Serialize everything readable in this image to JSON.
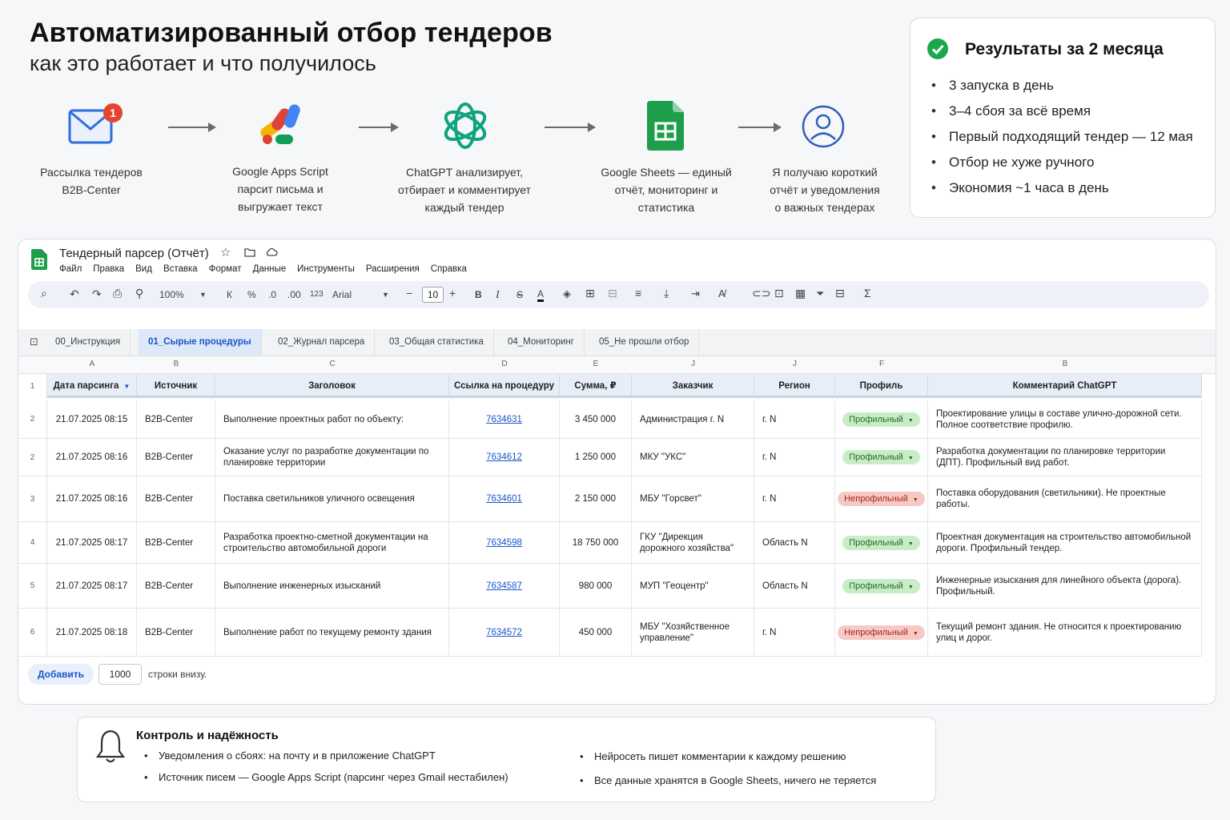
{
  "header": {
    "title": "Автоматизированный отбор тендеров",
    "subtitle": "как это работает и что получилось"
  },
  "flow": [
    {
      "icon": "envelope-icon",
      "badge": "1",
      "lines": [
        "Рассылка тендеров",
        "B2B-Center"
      ]
    },
    {
      "icon": "apps-script-icon",
      "lines": [
        "Google Apps Script",
        "парсит письма и",
        "выгружает текст"
      ]
    },
    {
      "icon": "chatgpt-icon",
      "lines": [
        "ChatGPT анализирует,",
        "отбирает и комментирует",
        "каждый тендер"
      ]
    },
    {
      "icon": "google-sheets-icon",
      "lines": [
        "Google Sheets — единый",
        "отчёт, мониторинг и",
        "статистика"
      ]
    },
    {
      "icon": "user-icon",
      "lines": [
        "Я получаю короткий",
        "отчёт и уведомления",
        "о важных тендерах"
      ]
    }
  ],
  "results": {
    "title": "Результаты за 2 месяца",
    "items": [
      "3 запуска в день",
      "3–4 сбоя за всё время",
      "Первый подходящий тендер — 12 мая",
      "Отбор не хуже ручного",
      "Экономия ~1 часа в день"
    ]
  },
  "sheet": {
    "doc_title": "Тендерный парсер (Отчёт)",
    "menu": [
      "Файл",
      "Правка",
      "Вид",
      "Вставка",
      "Формат",
      "Данные",
      "Инструменты",
      "Расширения",
      "Справка"
    ],
    "toolbar": {
      "zoom": "100%",
      "currency": "К",
      "percent": "%",
      "dec_less": ".0",
      "dec_more": ".00",
      "format_123": "123",
      "font": "Arial",
      "font_size": "10"
    },
    "tabs": [
      "00_Инструкция",
      "01_Сырые процедуры",
      "02_Журнал парсера",
      "03_Общая статистика",
      "04_Мониторинг",
      "05_Не прошли отбор"
    ],
    "active_tab": 1,
    "column_letters": [
      "A",
      "B",
      "C",
      "D",
      "E",
      "J",
      "J",
      "F",
      "B"
    ],
    "header_row_num": "1",
    "headers": [
      "Дата парсинга",
      "Источник",
      "Заголовок",
      "Ссылка на процедуру",
      "Сумма, ₽",
      "Заказчик",
      "Регион",
      "Профиль",
      "Комментарий ChatGPT"
    ],
    "rows": [
      {
        "num": "2",
        "date": "21.07.2025 08:15",
        "source": "B2B-Center",
        "title": "Выполнение проектных работ по объекту:",
        "link": "7634631",
        "sum": "3 450 000",
        "customer": "Администрация г. N",
        "region": "г. N",
        "profile": "Профильный",
        "profile_ok": true,
        "comment": "Проектирование улицы в составе улично-дорожной сети. Полное соответствие профилю."
      },
      {
        "num": "2",
        "date": "21.07.2025 08:16",
        "source": "B2B-Center",
        "title": "Оказание услуг по разработке документации по планировке территории",
        "link": "7634612",
        "sum": "1 250 000",
        "customer": "МКУ \"УКС\"",
        "region": "г. N",
        "profile": "Профильный",
        "profile_ok": true,
        "comment": "Разработка документации по планировке территории (ДПТ). Профильный вид работ."
      },
      {
        "num": "3",
        "date": "21.07.2025 08:16",
        "source": "B2B-Center",
        "title": "Поставка светильников уличного освещения",
        "link": "7634601",
        "sum": "2 150 000",
        "customer": "МБУ \"Горсвет\"",
        "region": "г. N",
        "profile": "Непрофильный",
        "profile_ok": false,
        "comment": "Поставка оборудования (светильники). Не проектные работы."
      },
      {
        "num": "4",
        "date": "21.07.2025 08:17",
        "source": "B2B-Center",
        "title": "Разработка проектно-сметной документации на строительство автомобильной дороги",
        "link": "7634598",
        "sum": "18 750 000",
        "customer": "ГКУ \"Дирекция дорожного хозяйства\"",
        "region": "Область N",
        "profile": "Профильный",
        "profile_ok": true,
        "comment": "Проектная документация на строительство автомобильной дороги. Профильный тендер."
      },
      {
        "num": "5",
        "date": "21.07.2025 08:17",
        "source": "B2B-Center",
        "title": "Выполнение инженерных изысканий",
        "link": "7634587",
        "sum": "980 000",
        "customer": "МУП \"Геоцентр\"",
        "region": "Область N",
        "profile": "Профильный",
        "profile_ok": true,
        "comment": "Инженерные изыскания для линейного объекта (дорога). Профильный."
      },
      {
        "num": "6",
        "date": "21.07.2025 08:18",
        "source": "B2B-Center",
        "title": "Выполнение работ по текущему ремонту здания",
        "link": "7634572",
        "sum": "450 000",
        "customer": "МБУ \"Хозяйственное управление\"",
        "region": "г. N",
        "profile": "Непрофильный",
        "profile_ok": false,
        "comment": "Текущий ремонт здания. Не относится к проектированию улиц и дорог."
      }
    ],
    "add_rows": {
      "button": "Добавить",
      "count": "1000",
      "suffix": "строки внизу."
    }
  },
  "control": {
    "title": "Контроль и надёжность",
    "left": [
      "Уведомления о сбоях: на почту и в приложение ChatGPT",
      "Источник писем — Google Apps Script (парсинг через Gmail нестабилен)"
    ],
    "right": [
      "Нейросеть пишет комментарии к каждому решению",
      "Все данные хранятся в Google Sheets, ничего не теряется"
    ]
  },
  "colors": {
    "accent": "#1a56c8",
    "ok_chip": "#c8edc6",
    "bad_chip": "#f6c9c5",
    "sheets_green": "#1e9e4a",
    "check_green": "#1aa84d",
    "chatgpt_green": "#10a37f"
  }
}
